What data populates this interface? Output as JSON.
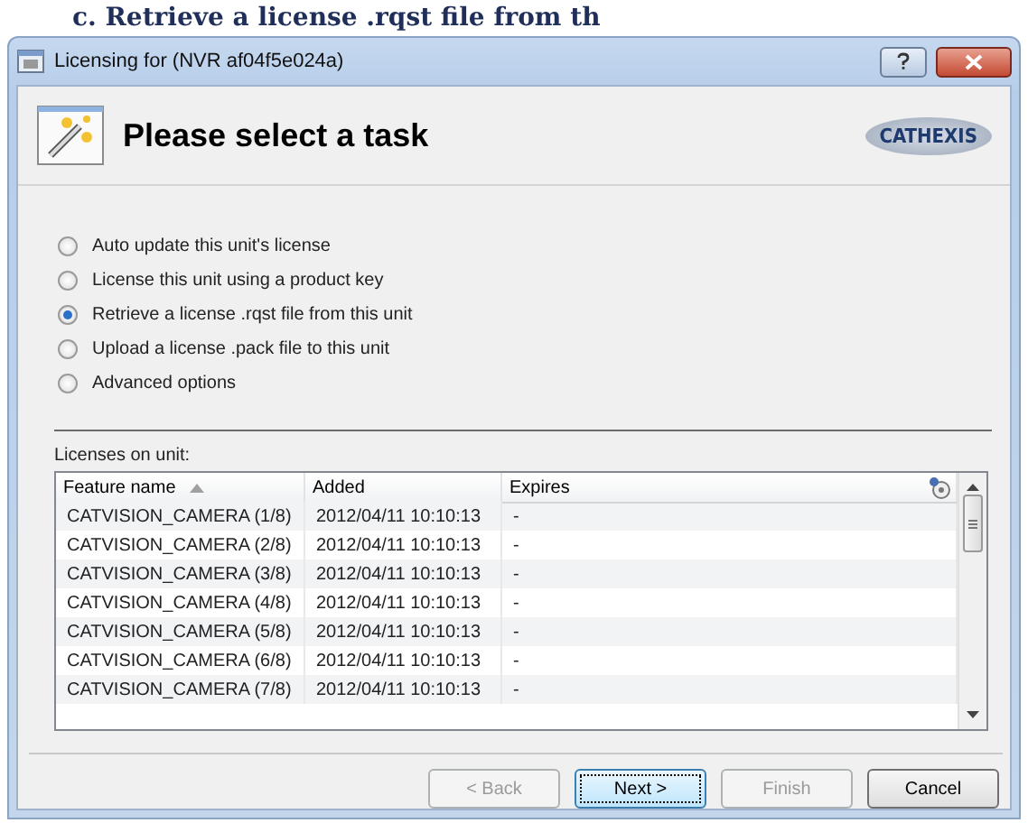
{
  "heading": "c. Retrieve a license .rqst file from th",
  "window": {
    "title": "Licensing for (NVR af04f5e024a)"
  },
  "header": {
    "title": "Please select a task",
    "logo": "CATHEXIS"
  },
  "options": [
    {
      "label": "Auto update this unit's license",
      "selected": false
    },
    {
      "label": "License this unit using a product key",
      "selected": false
    },
    {
      "label": "Retrieve a license .rqst file from this unit",
      "selected": true
    },
    {
      "label": "Upload a license .pack file to this unit",
      "selected": false
    },
    {
      "label": "Advanced options",
      "selected": false
    }
  ],
  "licenses": {
    "label": "Licenses on unit:",
    "columns": [
      {
        "label": "Feature name",
        "sorted": true
      },
      {
        "label": "Added",
        "sorted": false
      },
      {
        "label": "Expires",
        "sorted": false
      }
    ],
    "rows": [
      [
        "CATVISION_CAMERA (1/8)",
        "2012/04/11 10:10:13",
        "-"
      ],
      [
        "CATVISION_CAMERA (2/8)",
        "2012/04/11 10:10:13",
        "-"
      ],
      [
        "CATVISION_CAMERA (3/8)",
        "2012/04/11 10:10:13",
        "-"
      ],
      [
        "CATVISION_CAMERA (4/8)",
        "2012/04/11 10:10:13",
        "-"
      ],
      [
        "CATVISION_CAMERA (5/8)",
        "2012/04/11 10:10:13",
        "-"
      ],
      [
        "CATVISION_CAMERA (6/8)",
        "2012/04/11 10:10:13",
        "-"
      ],
      [
        "CATVISION_CAMERA (7/8)",
        "2012/04/11 10:10:13",
        "-"
      ]
    ]
  },
  "buttons": [
    {
      "label": "< Back",
      "disabled": true,
      "default": false
    },
    {
      "label": "Next >",
      "disabled": false,
      "default": true
    },
    {
      "label": "Finish",
      "disabled": true,
      "default": false
    },
    {
      "label": "Cancel",
      "disabled": false,
      "default": false
    }
  ]
}
